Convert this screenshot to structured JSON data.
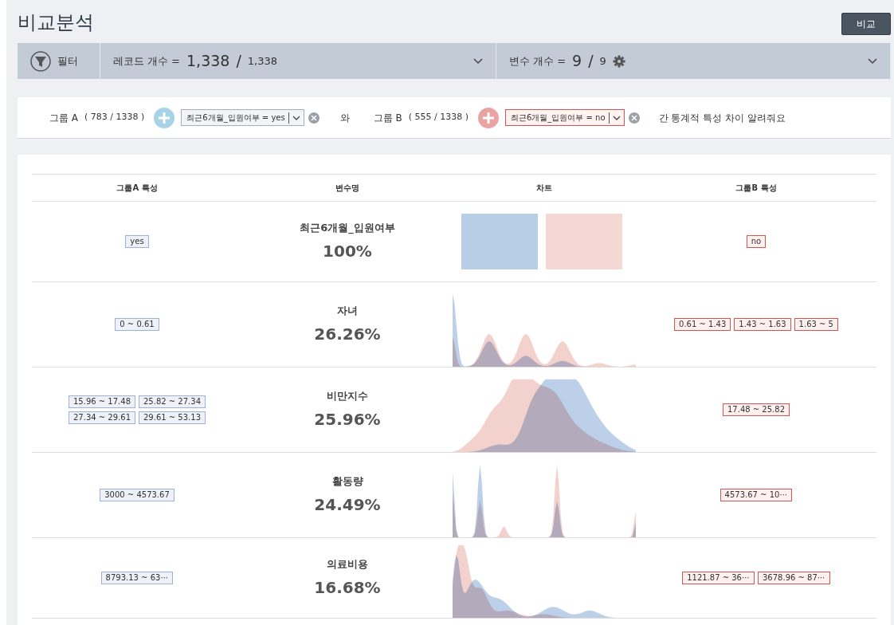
{
  "title": "비교분석",
  "compare_button": "비교",
  "filter_bar": {
    "label": "필터",
    "records": {
      "label": "레코드 개수 =",
      "selected": "1,338",
      "separator": "/",
      "total": "1,338"
    },
    "variables": {
      "label": "변수 개수 =",
      "selected": "9",
      "separator": "/",
      "total": "9"
    }
  },
  "groups": [
    {
      "kind": "a",
      "label": "그룹 A",
      "count": "( 783 / 1338 )",
      "condition": "최근6개월_입원여부 = yes"
    },
    {
      "kind": "b",
      "label": "그룹 B",
      "count": "( 555 / 1338 )",
      "condition": "최근6개월_입원여부 = no"
    }
  ],
  "connector": "와",
  "question": "간 통계적 특성 차이 알려줘요",
  "table": {
    "columns": [
      "그룹A 특성",
      "변수명",
      "차트",
      "그룹B 특성"
    ],
    "rows": [
      {
        "group_a": [
          "yes"
        ],
        "variable": "최근6개월_입원여부",
        "percent": "100%",
        "chart": {
          "kind": "bars"
        },
        "group_b": [
          "no"
        ]
      },
      {
        "group_a": [
          "0 ~ 0.61"
        ],
        "variable": "자녀",
        "percent": "26.26%",
        "chart": {
          "kind": "density"
        },
        "group_b": [
          "0.61 ~ 1.43",
          "1.43 ~ 1.63",
          "1.63 ~ 5"
        ]
      },
      {
        "group_a": [
          "15.96 ~ 17.48",
          "25.82 ~ 27.34",
          "27.34 ~ 29.61",
          "29.61 ~ 53.13"
        ],
        "variable": "비만지수",
        "percent": "25.96%",
        "chart": {
          "kind": "density"
        },
        "group_b": [
          "17.48 ~ 25.82"
        ]
      },
      {
        "group_a": [
          "3000 ~ 4573.67"
        ],
        "variable": "활동량",
        "percent": "24.49%",
        "chart": {
          "kind": "density"
        },
        "group_b": [
          "4573.67 ~ 10⋯"
        ]
      },
      {
        "group_a": [
          "8793.13 ~ 63⋯"
        ],
        "variable": "의료비용",
        "percent": "16.68%",
        "chart": {
          "kind": "density"
        },
        "group_b": [
          "1121.87 ~ 36⋯",
          "3678.96 ~ 87⋯"
        ]
      }
    ]
  }
}
